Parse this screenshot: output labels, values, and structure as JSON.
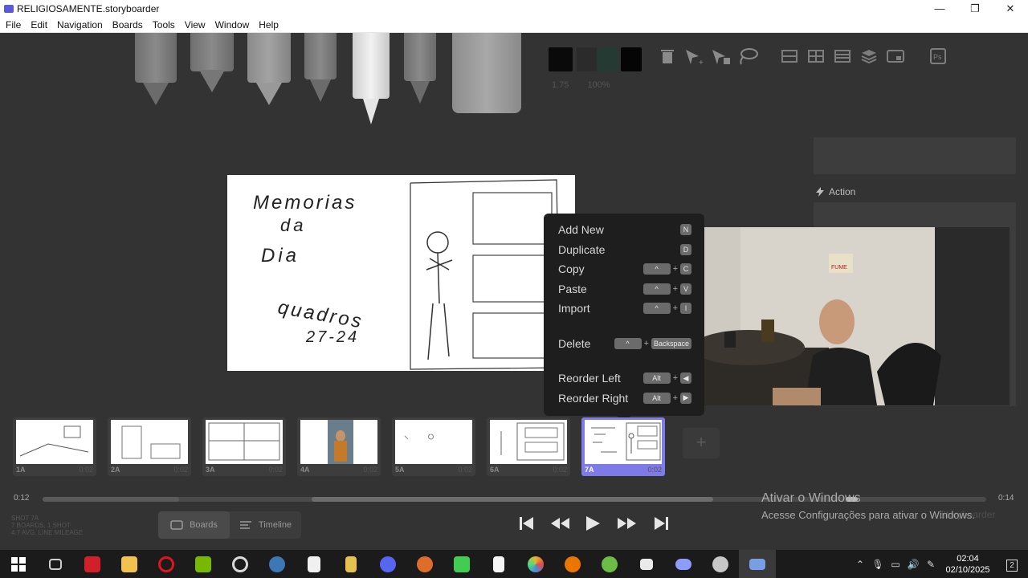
{
  "window": {
    "title": "RELIGIOSAMENTE.storyboarder",
    "minimize": "—",
    "restore": "❐",
    "close": "✕"
  },
  "menu": [
    "File",
    "Edit",
    "Navigation",
    "Boards",
    "Tools",
    "View",
    "Window",
    "Help"
  ],
  "toolbar": {
    "colors": [
      "#0a0a0a",
      "#2b2b2b",
      "#243a33",
      "#050505"
    ],
    "brush_size": "1.75",
    "brush_opacity": "100%"
  },
  "panel": {
    "action_label": "Action"
  },
  "canvas_sketch": {
    "lines": [
      "Memorias",
      "da",
      "Dia",
      "quadros",
      "27-24"
    ]
  },
  "context_menu": {
    "items": [
      {
        "label": "Add New",
        "keys": [
          "N"
        ]
      },
      {
        "label": "Duplicate",
        "keys": [
          "D"
        ]
      },
      {
        "label": "Copy",
        "keys": [
          "^",
          "C"
        ]
      },
      {
        "label": "Paste",
        "keys": [
          "^",
          "V"
        ]
      },
      {
        "label": "Import",
        "keys": [
          "^",
          "I"
        ]
      },
      {
        "label": "Delete",
        "keys": [
          "^",
          "Backspace"
        ]
      },
      {
        "label": "Reorder Left",
        "keys": [
          "Alt",
          "◀"
        ]
      },
      {
        "label": "Reorder Right",
        "keys": [
          "Alt",
          "▶"
        ]
      }
    ]
  },
  "webcam": {
    "sign_text": "FUME"
  },
  "boards": [
    {
      "num": "1A",
      "dur": "0:02"
    },
    {
      "num": "2A",
      "dur": "0:02"
    },
    {
      "num": "3A",
      "dur": "0:02"
    },
    {
      "num": "4A",
      "dur": "0:02"
    },
    {
      "num": "5A",
      "dur": "0:02"
    },
    {
      "num": "6A",
      "dur": "0:02"
    },
    {
      "num": "7A",
      "dur": "0:02"
    }
  ],
  "add_board": "+",
  "timeline": {
    "current": "0:12",
    "total": "0:14"
  },
  "stats": {
    "shot": "SHOT 7A",
    "counts": "7 BOARDS, 1 SHOT",
    "mileage": "4.7 AVG. LINE MILEAGE"
  },
  "view_toggle": {
    "boards": "Boards",
    "timeline": "Timeline"
  },
  "activation": {
    "line1": "Ativar o Windows",
    "line2": "Acesse Configurações para ativar o Windows.",
    "faint": "Storyboarder"
  },
  "taskbar": {
    "apps": [
      {
        "name": "start",
        "color": "#4aa3ff"
      },
      {
        "name": "task-view",
        "color": "#cfcfcf"
      },
      {
        "name": "amd",
        "color": "#d21f2a"
      },
      {
        "name": "explorer",
        "color": "#f2c14e"
      },
      {
        "name": "opera",
        "color": "#e0141e"
      },
      {
        "name": "nvidia",
        "color": "#76b900"
      },
      {
        "name": "obs",
        "color": "#d9d9d9"
      },
      {
        "name": "steam",
        "color": "#3b78b5"
      },
      {
        "name": "epic",
        "color": "#f0f0f0"
      },
      {
        "name": "app-9",
        "color": "#e5c14d"
      },
      {
        "name": "discord",
        "color": "#5865f2"
      },
      {
        "name": "app-11",
        "color": "#e06c2a"
      },
      {
        "name": "qt",
        "color": "#41cd52"
      },
      {
        "name": "notepad",
        "color": "#f5f5f5"
      },
      {
        "name": "davinci",
        "color": "#e8b32e"
      },
      {
        "name": "blender",
        "color": "#ea7600"
      },
      {
        "name": "xbox",
        "color": "#6bbd45"
      },
      {
        "name": "capcut",
        "color": "#eaeaea"
      },
      {
        "name": "gamepad",
        "color": "#8f9cff"
      },
      {
        "name": "app-20",
        "color": "#c7c7c7"
      },
      {
        "name": "storyboarder",
        "color": "#7a9ee6"
      }
    ],
    "time": "02:04",
    "date": "02/10/2025",
    "notifications": "2"
  }
}
